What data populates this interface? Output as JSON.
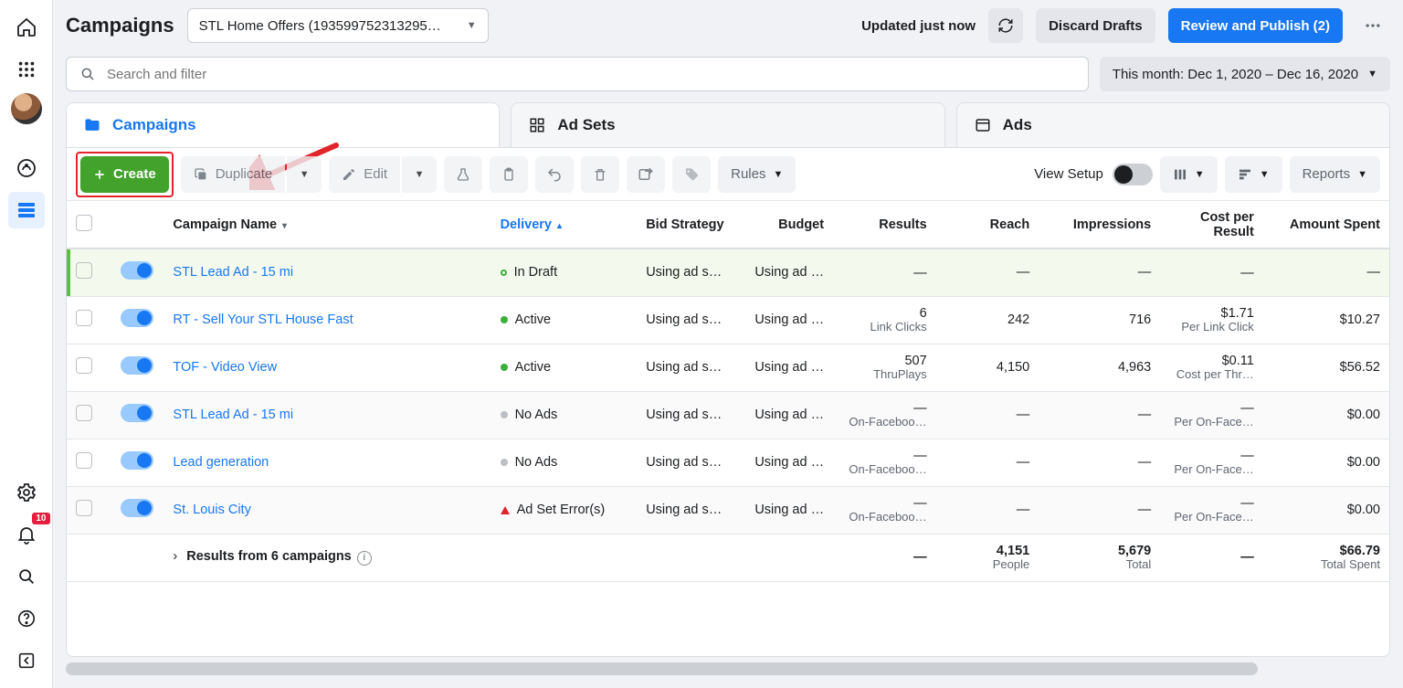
{
  "header": {
    "title": "Campaigns",
    "account": "STL Home Offers (193599752313295…",
    "status": "Updated just now",
    "discard": "Discard Drafts",
    "publish": "Review and Publish (2)"
  },
  "rail": {
    "notif_count": "10"
  },
  "search": {
    "placeholder": "Search and filter"
  },
  "daterange": "This month: Dec 1, 2020 – Dec 16, 2020",
  "tabs": {
    "campaigns": "Campaigns",
    "adsets": "Ad Sets",
    "ads": "Ads"
  },
  "toolbar": {
    "create": "Create",
    "duplicate": "Duplicate",
    "edit": "Edit",
    "rules": "Rules",
    "view_setup": "View Setup",
    "reports": "Reports"
  },
  "columns": {
    "name": "Campaign Name",
    "delivery": "Delivery",
    "bid": "Bid Strategy",
    "budget": "Budget",
    "results": "Results",
    "reach": "Reach",
    "impressions": "Impressions",
    "cpr": "Cost per Result",
    "spent": "Amount Spent"
  },
  "rows": [
    {
      "name": "STL Lead Ad - 15 mi",
      "delivery": "In Draft",
      "delivery_kind": "draft",
      "bid": "Using ad s…",
      "budget": "Using ad …",
      "results": "—",
      "results_sub": "",
      "reach": "—",
      "impr": "—",
      "cpr": "—",
      "cpr_sub": "",
      "spent": "—",
      "class": "row-draft"
    },
    {
      "name": "RT - Sell Your STL House Fast",
      "delivery": "Active",
      "delivery_kind": "active",
      "bid": "Using ad s…",
      "budget": "Using ad …",
      "results": "6",
      "results_sub": "Link Clicks",
      "reach": "242",
      "impr": "716",
      "cpr": "$1.71",
      "cpr_sub": "Per Link Click",
      "spent": "$10.27",
      "class": ""
    },
    {
      "name": "TOF - Video View",
      "delivery": "Active",
      "delivery_kind": "active",
      "bid": "Using ad s…",
      "budget": "Using ad …",
      "results": "507",
      "results_sub": "ThruPlays",
      "reach": "4,150",
      "impr": "4,963",
      "cpr": "$0.11",
      "cpr_sub": "Cost per Thr…",
      "spent": "$56.52",
      "class": ""
    },
    {
      "name": "STL Lead Ad - 15 mi",
      "delivery": "No Ads",
      "delivery_kind": "none",
      "bid": "Using ad s…",
      "budget": "Using ad …",
      "results": "—",
      "results_sub": "On-Faceboo…",
      "reach": "—",
      "impr": "—",
      "cpr": "—",
      "cpr_sub": "Per On-Face…",
      "spent": "$0.00",
      "class": "row-alt"
    },
    {
      "name": "Lead generation",
      "delivery": "No Ads",
      "delivery_kind": "none",
      "bid": "Using ad s…",
      "budget": "Using ad …",
      "results": "—",
      "results_sub": "On-Faceboo…",
      "reach": "—",
      "impr": "—",
      "cpr": "—",
      "cpr_sub": "Per On-Face…",
      "spent": "$0.00",
      "class": ""
    },
    {
      "name": "St. Louis City",
      "delivery": "Ad Set Error(s)",
      "delivery_kind": "error",
      "bid": "Using ad s…",
      "budget": "Using ad …",
      "results": "—",
      "results_sub": "On-Faceboo…",
      "reach": "—",
      "impr": "—",
      "cpr": "—",
      "cpr_sub": "Per On-Face…",
      "spent": "$0.00",
      "class": "row-alt"
    }
  ],
  "summary": {
    "label": "Results from 6 campaigns",
    "results": "—",
    "reach": "4,151",
    "reach_sub": "People",
    "impr": "5,679",
    "impr_sub": "Total",
    "cpr": "—",
    "spent": "$66.79",
    "spent_sub": "Total Spent"
  }
}
